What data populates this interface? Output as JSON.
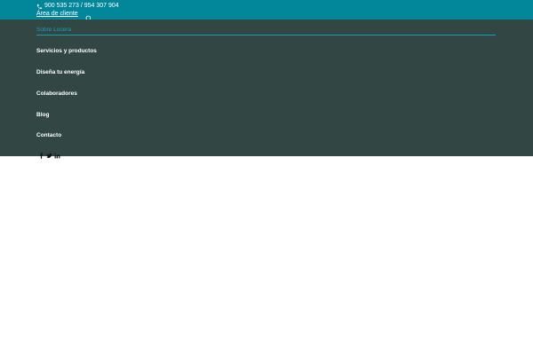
{
  "header": {
    "phone": "900 535 273 / 954 307 904",
    "client_area": "Área de cliente",
    "icons": {
      "phone": "phone-icon",
      "search": "search-icon"
    }
  },
  "menu": {
    "items": [
      {
        "label": "Sobre Lucera",
        "active": true
      },
      {
        "label": "Servicios y productos",
        "active": false
      },
      {
        "label": "Diseña tu energía",
        "active": false
      },
      {
        "label": "Colaboradores",
        "active": false
      },
      {
        "label": "Blog",
        "active": false
      },
      {
        "label": "Contacto",
        "active": false
      }
    ],
    "social": [
      "facebook-icon",
      "twitter-icon",
      "linkedin-icon"
    ]
  },
  "colors": {
    "topbar": "#02869a",
    "menu_background": "#324744",
    "accent": "#12a2b5",
    "text": "#ffffff"
  }
}
